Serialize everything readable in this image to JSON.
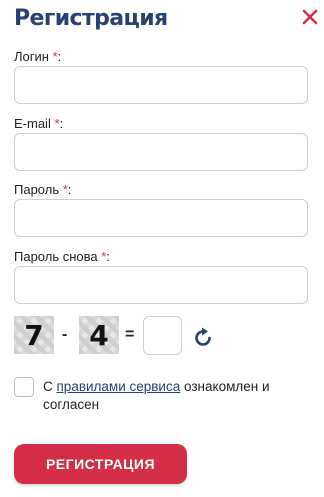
{
  "title": "Регистрация",
  "close_icon": "close-icon",
  "fields": [
    {
      "label": "Логин",
      "required_mark": "*",
      "suffix": ":",
      "value": ""
    },
    {
      "label": "E-mail",
      "required_mark": "*",
      "suffix": ":",
      "value": ""
    },
    {
      "label": "Пароль",
      "required_mark": "*",
      "suffix": ":",
      "value": ""
    },
    {
      "label": "Пароль снова",
      "required_mark": "*",
      "suffix": ":",
      "value": ""
    }
  ],
  "captcha": {
    "first": "7",
    "operator": "-",
    "second": "4",
    "equals": "=",
    "answer": "",
    "refresh_icon": "refresh-icon"
  },
  "agreement": {
    "checked": false,
    "prefix": "С ",
    "link": "правилами сервиса",
    "suffix": " ознакомлен и согласен"
  },
  "submit_label": "РЕГИСТРАЦИЯ",
  "colors": {
    "title": "#2a3f73",
    "accent": "#d42e46",
    "required": "#d02e44"
  }
}
